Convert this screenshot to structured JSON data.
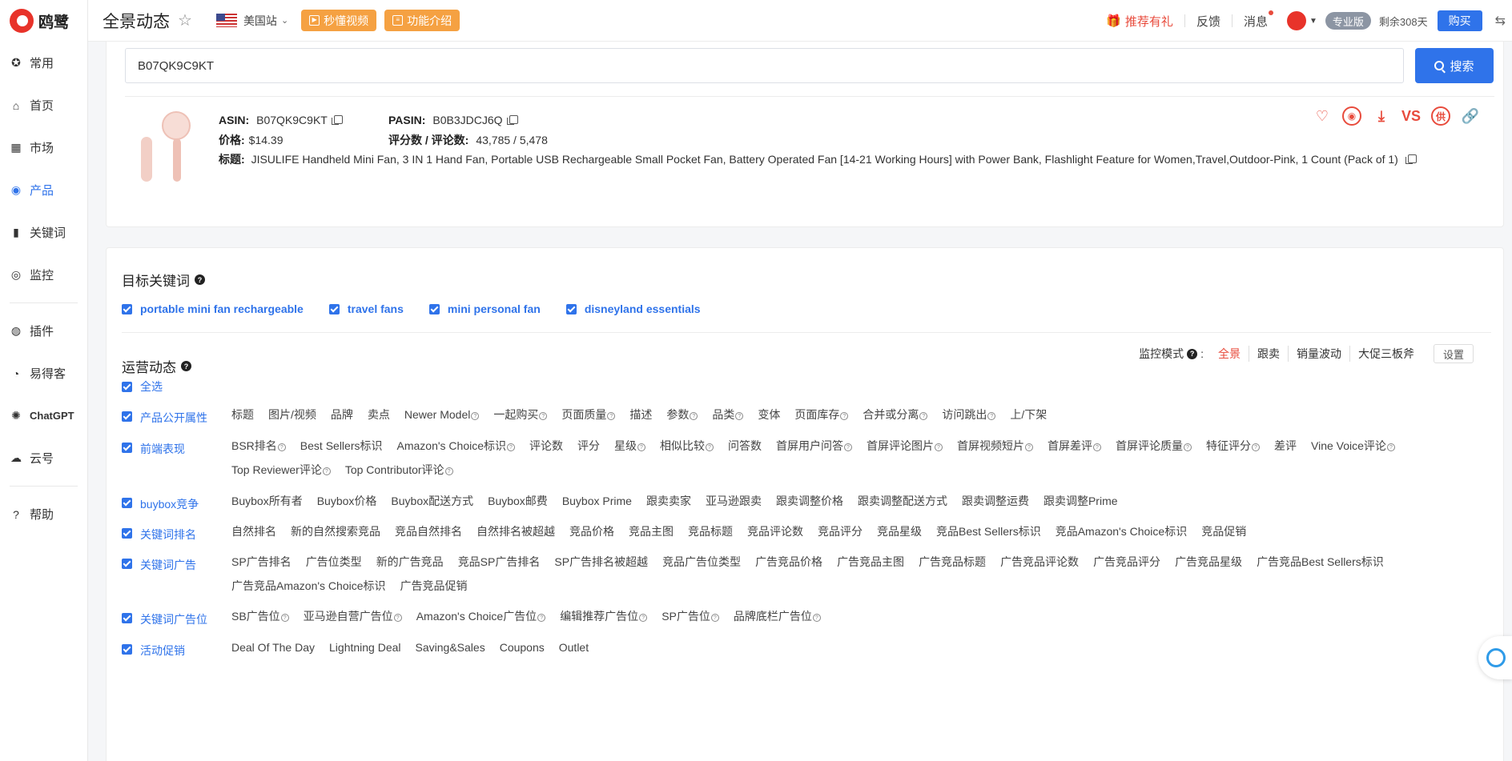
{
  "app": {
    "logo_text": "鸥鹭"
  },
  "sidebar": {
    "items": [
      {
        "label": "常用",
        "icon": "star-icon"
      },
      {
        "label": "首页",
        "icon": "home-icon"
      },
      {
        "label": "市场",
        "icon": "grid-icon"
      },
      {
        "label": "产品",
        "icon": "eye-icon",
        "active": true
      },
      {
        "label": "关键词",
        "icon": "bar-chart-icon"
      },
      {
        "label": "监控",
        "icon": "webcam-icon"
      }
    ],
    "items2": [
      {
        "label": "插件",
        "icon": "chrome-icon"
      },
      {
        "label": "易得客",
        "icon": "coin-icon"
      },
      {
        "label": "ChatGPT",
        "icon": "openai-icon"
      },
      {
        "label": "云号",
        "icon": "cloud-icon"
      }
    ],
    "items3": [
      {
        "label": "帮助",
        "icon": "help-icon"
      }
    ]
  },
  "header": {
    "title": "全景动态",
    "site": "美国站",
    "btn_video": "秒懂视频",
    "btn_intro": "功能介绍",
    "gift": "推荐有礼",
    "feedback": "反馈",
    "messages": "消息",
    "plan": "专业版",
    "remaining": "剩余308天",
    "buy": "购买"
  },
  "search": {
    "value": "B07QK9C9KT",
    "button": "搜索"
  },
  "product": {
    "asin_label": "ASIN:",
    "asin": "B07QK9C9KT",
    "pasin_label": "PASIN:",
    "pasin": "B0B3JDCJ6Q",
    "price_label": "价格:",
    "price": "$14.39",
    "rating_label": "评分数 / 评论数:",
    "rating": "43,785 / 5,478",
    "title_label": "标题:",
    "title": "JISULIFE Handheld Mini Fan, 3 IN 1 Hand Fan, Portable USB Rechargeable Small Pocket Fan, Battery Operated Fan [14-21 Working Hours] with Power Bank, Flashlight Feature for Women,Travel,Outdoor-Pink, 1 Count (Pack of 1)",
    "action_vs": "VS",
    "action_supply": "供"
  },
  "target_keywords": {
    "title": "目标关键词",
    "items": [
      "portable mini fan rechargeable",
      "travel fans",
      "mini personal fan",
      "disneyland essentials"
    ]
  },
  "operations": {
    "title": "运营动态",
    "mode_label": "监控模式",
    "modes": [
      "全景",
      "跟卖",
      "销量波动",
      "大促三板斧"
    ],
    "settings": "设置",
    "select_all": "全选",
    "rows": [
      {
        "name": "产品公开属性",
        "items": [
          "标题",
          "图片/视频",
          "品牌",
          "卖点",
          "Newer Model",
          "一起购买",
          "页面质量",
          "描述",
          "参数",
          "品类",
          "变体",
          "页面库存",
          "合并或分离",
          "访问跳出",
          "上/下架"
        ],
        "help": [
          4,
          5,
          6,
          8,
          9,
          11,
          12,
          13
        ]
      },
      {
        "name": "前端表现",
        "items": [
          "BSR排名",
          "Best Sellers标识",
          "Amazon's Choice标识",
          "评论数",
          "评分",
          "星级",
          "相似比较",
          "问答数",
          "首屏用户问答",
          "首屏评论图片",
          "首屏视频短片",
          "首屏差评",
          "首屏评论质量",
          "特征评分",
          "差评",
          "Vine Voice评论",
          "Top Reviewer评论",
          "Top Contributor评论"
        ],
        "help": [
          0,
          2,
          5,
          6,
          8,
          9,
          10,
          11,
          12,
          13,
          15,
          16,
          17
        ]
      },
      {
        "name": "buybox竞争",
        "items": [
          "Buybox所有者",
          "Buybox价格",
          "Buybox配送方式",
          "Buybox邮费",
          "Buybox Prime",
          "跟卖卖家",
          "亚马逊跟卖",
          "跟卖调整价格",
          "跟卖调整配送方式",
          "跟卖调整运费",
          "跟卖调整Prime"
        ],
        "help": []
      },
      {
        "name": "关键词排名",
        "items": [
          "自然排名",
          "新的自然搜索竞品",
          "竞品自然排名",
          "自然排名被超越",
          "竞品价格",
          "竞品主图",
          "竞品标题",
          "竞品评论数",
          "竞品评分",
          "竞品星级",
          "竞品Best Sellers标识",
          "竞品Amazon's Choice标识",
          "竞品促销"
        ],
        "help": []
      },
      {
        "name": "关键词广告",
        "items": [
          "SP广告排名",
          "广告位类型",
          "新的广告竞品",
          "竞品SP广告排名",
          "SP广告排名被超越",
          "竞品广告位类型",
          "广告竞品价格",
          "广告竞品主图",
          "广告竞品标题",
          "广告竞品评论数",
          "广告竞品评分",
          "广告竞品星级",
          "广告竞品Best Sellers标识",
          "广告竞品Amazon's Choice标识",
          "广告竞品促销"
        ],
        "help": []
      },
      {
        "name": "关键词广告位",
        "items": [
          "SB广告位",
          "亚马逊自营广告位",
          "Amazon's Choice广告位",
          "编辑推荐广告位",
          "SP广告位",
          "品牌底栏广告位"
        ],
        "help": [
          0,
          1,
          2,
          3,
          4,
          5
        ]
      },
      {
        "name": "活动促销",
        "items": [
          "Deal Of The Day",
          "Lightning Deal",
          "Saving&Sales",
          "Coupons",
          "Outlet"
        ],
        "help": []
      }
    ]
  }
}
